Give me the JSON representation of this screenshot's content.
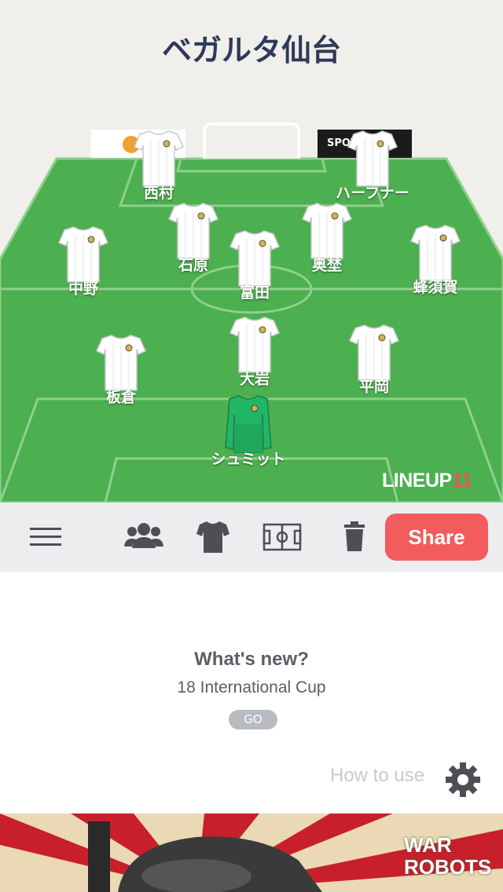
{
  "header": {
    "title": "ベガルタ仙台"
  },
  "pitch": {
    "ad_right_text": "SPOT",
    "brand_main": "LINEUP",
    "brand_num": "11",
    "colors": {
      "grass": "#4caf50",
      "grass_dark": "#43a047",
      "lines": "#8fd08c",
      "kit": "#ffffff",
      "gk_kit": "#22b566"
    }
  },
  "players": [
    {
      "name": "西村",
      "kit": "white"
    },
    {
      "name": "ハーフナー",
      "kit": "white"
    },
    {
      "name": "石原",
      "kit": "white"
    },
    {
      "name": "奥埜",
      "kit": "white"
    },
    {
      "name": "中野",
      "kit": "white"
    },
    {
      "name": "富田",
      "kit": "white"
    },
    {
      "name": "蜂須賀",
      "kit": "white"
    },
    {
      "name": "板倉",
      "kit": "white"
    },
    {
      "name": "大岩",
      "kit": "white"
    },
    {
      "name": "平岡",
      "kit": "white"
    },
    {
      "name": "シュミット",
      "kit": "goalkeeper-green"
    }
  ],
  "toolbar": {
    "icons": [
      "menu-icon",
      "team-icon",
      "shirt-icon",
      "field-icon",
      "trash-icon"
    ],
    "share_label": "Share"
  },
  "whats_new": {
    "title": "What's new?",
    "subtitle": "18 International Cup",
    "go_label": "GO"
  },
  "footer": {
    "how_to_use": "How to use"
  },
  "banner": {
    "logo_line1": "WAR",
    "logo_line2": "ROBOTS"
  }
}
